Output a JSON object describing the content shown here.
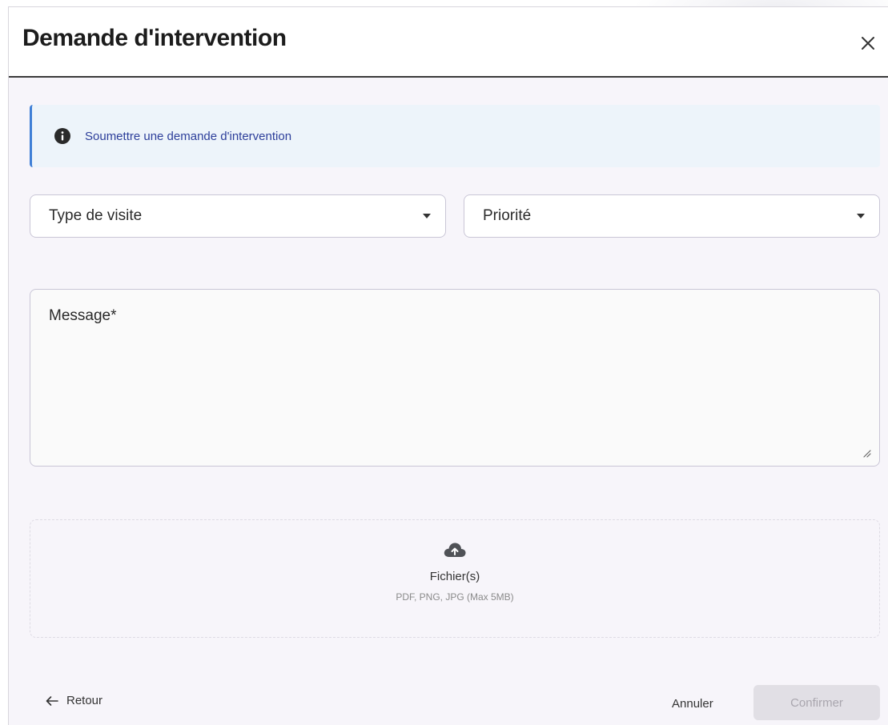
{
  "dialog": {
    "title": "Demande d'intervention",
    "close_icon": "close-icon"
  },
  "banner": {
    "icon": "info-icon",
    "text": "Soumettre une demande d'intervention",
    "accent_color": "#3f7fd6"
  },
  "form": {
    "type_select": {
      "label": "Type de visite",
      "icon": "caret-down-icon"
    },
    "priority_select": {
      "label": "Priorité",
      "icon": "caret-down-icon"
    },
    "message": {
      "label": "Message*"
    }
  },
  "dropzone": {
    "icon": "cloud-upload-icon",
    "label": "Fichier(s)",
    "hint": "PDF, PNG, JPG (Max 5MB)"
  },
  "footer": {
    "back_icon": "arrow-left-icon",
    "back_label": "Retour",
    "cancel_label": "Annuler",
    "confirm_label": "Confirmer",
    "confirm_disabled": true
  }
}
